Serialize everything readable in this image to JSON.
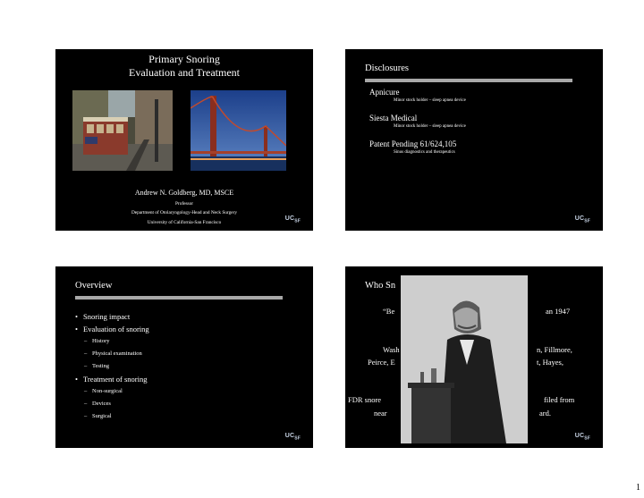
{
  "slide1": {
    "title_line1": "Primary Snoring",
    "title_line2": "Evaluation and Treatment",
    "author": "Andrew N. Goldberg, MD, MSCE",
    "affiliation": [
      "Professor",
      "Department of Otolaryngology-Head and Neck Surgery",
      "University of California-San Francisco"
    ]
  },
  "slide2": {
    "title": "Disclosures",
    "items": [
      {
        "heading": "Apnicure",
        "detail": "Minor stock holder – sleep apnea device"
      },
      {
        "heading": "Siesta Medical",
        "detail": "Minor stock holder – sleep apnea device"
      },
      {
        "heading": "Patent Pending 61/624,105",
        "detail": "Sinus diagnostics and therapeutics"
      }
    ]
  },
  "slide3": {
    "title": "Overview",
    "items": [
      {
        "level": 1,
        "text": "Snoring impact"
      },
      {
        "level": 1,
        "text": "Evaluation of snoring"
      },
      {
        "level": 2,
        "text": "History"
      },
      {
        "level": 2,
        "text": "Physical examination"
      },
      {
        "level": 2,
        "text": "Testing"
      },
      {
        "level": 1,
        "text": "Treatment of snoring"
      },
      {
        "level": 2,
        "text": "Non-surgical"
      },
      {
        "level": 2,
        "text": "Devices"
      },
      {
        "level": 2,
        "text": "Surgical"
      }
    ]
  },
  "slide4": {
    "title": "Who Sn",
    "quote_start": "“Be",
    "quote_end": "an 1947",
    "presidents_l1_start": "Wash",
    "presidents_l1_end": "n, Fillmore,",
    "presidents_l2_start": "Peirce, E",
    "presidents_l2_end": "t, Hayes,",
    "fdr_l1_start": "FDR snore",
    "fdr_l1_end": "filed from",
    "fdr_l2_start": "near",
    "fdr_l2_end": "ard."
  },
  "logo": {
    "main": "UC",
    "sub": "SF"
  },
  "page_number": "1"
}
